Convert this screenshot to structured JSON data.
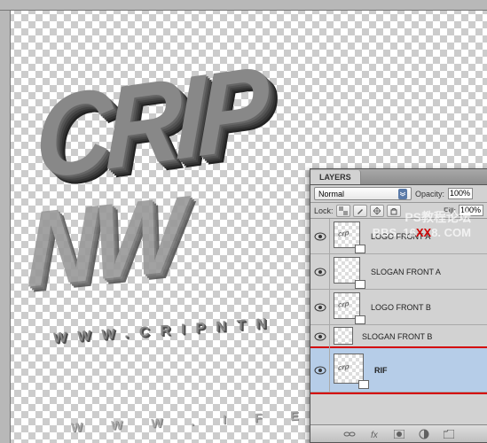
{
  "canvas": {
    "logo_text_a": "CRIP",
    "logo_text_b": "NW",
    "slogan_a": "WWW.CRIPNTN",
    "slogan_b": "W W W . I F E R R"
  },
  "panel": {
    "tab": "LAYERS",
    "blend_mode": "Normal",
    "opacity_label": "Opacity:",
    "opacity_value": "100%",
    "lock_label": "Lock:",
    "fill_label": "Fill:",
    "fill_value": "100%",
    "layers": [
      {
        "name": "LOGO FRONT A"
      },
      {
        "name": "SLOGAN FRONT A"
      },
      {
        "name": "LOGO FRONT B"
      },
      {
        "name": "SLOGAN FRONT B"
      },
      {
        "name": "RIF"
      }
    ]
  },
  "watermark": {
    "line1": "PS教程论坛",
    "line2_pre": "BBS. 16",
    "line2_mid": "XX",
    "line2_post": "8. COM"
  }
}
